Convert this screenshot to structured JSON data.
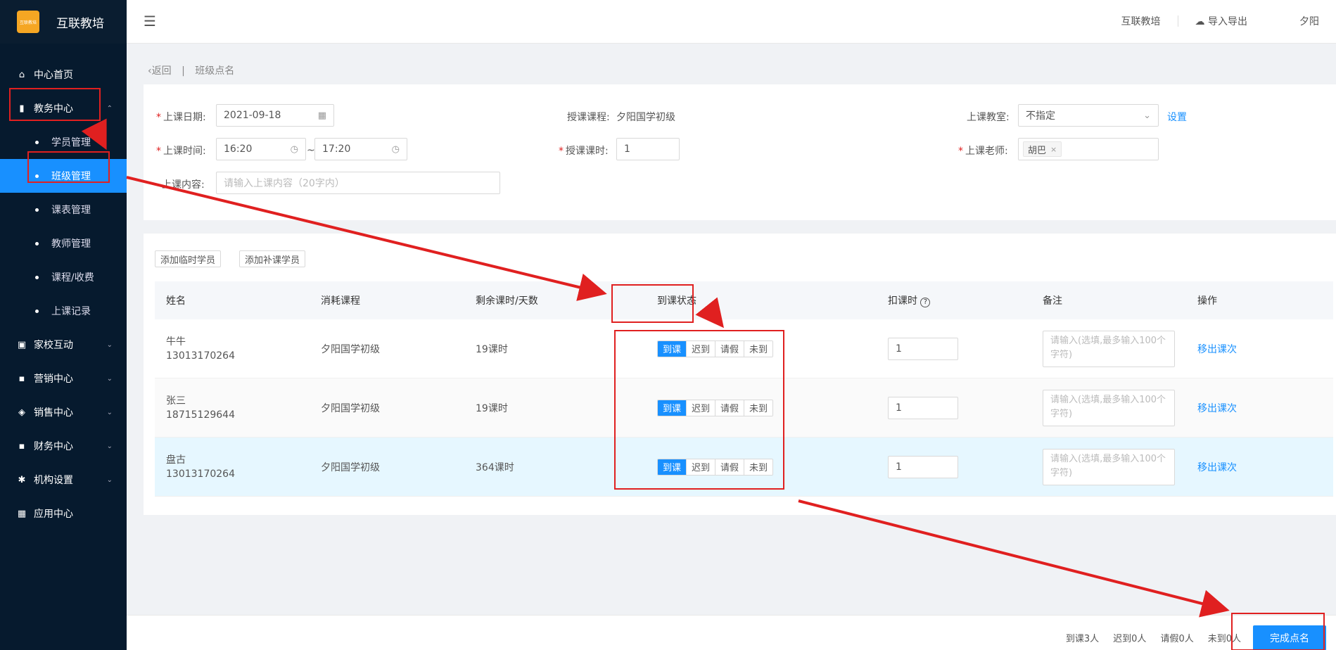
{
  "app": {
    "logo_text": "互联教培",
    "logo_mark": "互联教培"
  },
  "sidebar": {
    "items": [
      {
        "label": "中心首页",
        "icon": "home-icon"
      },
      {
        "label": "教务中心",
        "icon": "book-icon",
        "expanded": true,
        "children": [
          {
            "label": "学员管理"
          },
          {
            "label": "班级管理",
            "active": true
          },
          {
            "label": "课表管理"
          },
          {
            "label": "教师管理"
          },
          {
            "label": "课程/收费"
          },
          {
            "label": "上课记录"
          }
        ]
      },
      {
        "label": "家校互动",
        "icon": "chat-icon"
      },
      {
        "label": "营销中心",
        "icon": "bag-icon"
      },
      {
        "label": "销售中心",
        "icon": "sales-icon"
      },
      {
        "label": "财务中心",
        "icon": "wallet-icon"
      },
      {
        "label": "机构设置",
        "icon": "gear-icon"
      },
      {
        "label": "应用中心",
        "icon": "grid-icon"
      }
    ]
  },
  "header": {
    "org": "互联教培",
    "import_export": "导入导出",
    "user": "夕阳"
  },
  "breadcrumb": {
    "back": "返回",
    "separator": "|",
    "current": "班级点名"
  },
  "form": {
    "date_label": "上课日期:",
    "date_value": "2021-09-18",
    "time_label": "上课时间:",
    "time_start": "16:20",
    "time_sep": "~",
    "time_end": "17:20",
    "content_label": "上课内容:",
    "content_placeholder": "请输入上课内容（20字内）",
    "course_label": "授课课程:",
    "course_value": "夕阳国学初级",
    "hours_label": "授课课时:",
    "hours_value": "1",
    "room_label": "上课教室:",
    "room_value": "不指定",
    "room_setting": "设置",
    "teacher_label": "上课老师:",
    "teacher_tag": "胡巴"
  },
  "actions": {
    "add_temp": "添加临时学员",
    "add_makeup": "添加补课学员"
  },
  "table": {
    "headers": [
      "姓名",
      "消耗课程",
      "剩余课时/天数",
      "到课状态",
      "扣课时",
      "备注",
      "操作"
    ],
    "status_options": [
      "到课",
      "迟到",
      "请假",
      "未到"
    ],
    "note_placeholder": "请输入(选填,最多输入100个字符)",
    "remove_label": "移出课次",
    "rows": [
      {
        "name": "牛牛",
        "phone": "13013170264",
        "course": "夕阳国学初级",
        "remaining": "19课时",
        "deduct": "1"
      },
      {
        "name": "张三",
        "phone": "18715129644",
        "course": "夕阳国学初级",
        "remaining": "19课时",
        "deduct": "1"
      },
      {
        "name": "盘古",
        "phone": "13013170264",
        "course": "夕阳国学初级",
        "remaining": "364课时",
        "deduct": "1"
      }
    ]
  },
  "footer": {
    "present": "到课3人",
    "late": "迟到0人",
    "leave": "请假0人",
    "absent": "未到0人",
    "finish": "完成点名"
  },
  "colors": {
    "accent": "#1890ff",
    "sidebar_bg": "#061a2e",
    "annotation": "#e02020"
  }
}
